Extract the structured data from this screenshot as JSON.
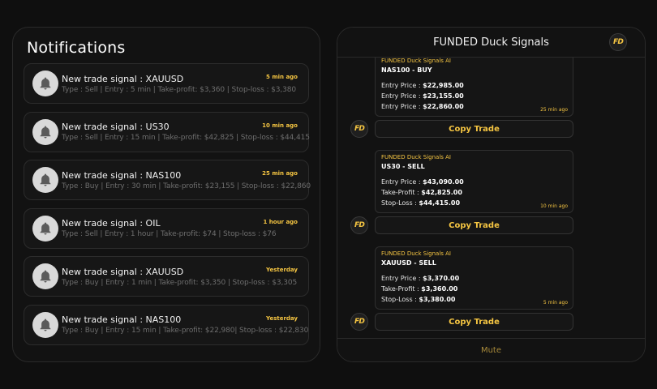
{
  "notifications": {
    "title": "Notifications",
    "items": [
      {
        "title": "New trade signal : XAUUSD",
        "details": "Type : Sell | Entry : 5 min | Take-profit: $3,360 | Stop-loss : $3,380",
        "time": "5 min ago"
      },
      {
        "title": "New trade signal : US30",
        "details": "Type : Sell | Entry : 15 min | Take-profit: $42,825 | Stop-loss : $44,415",
        "time": "10 min ago"
      },
      {
        "title": "New trade signal : NAS100",
        "details": "Type : Buy | Entry : 30 min | Take-profit: $23,155 | Stop-loss : $22,860",
        "time": "25 min ago"
      },
      {
        "title": "New trade signal : OIL",
        "details": "Type : Sell | Entry : 1 hour | Take-profit: $74 | Stop-loss : $76",
        "time": "1 hour ago"
      },
      {
        "title": "New trade signal : XAUUSD",
        "details": "Type : Buy | Entry : 1 min | Take-profit: $3,350 | Stop-loss : $3,305",
        "time": "Yesterday"
      },
      {
        "title": "New trade signal : NAS100",
        "details": "Type : Buy | Entry : 15 min | Take-profit: $22,980| Stop-loss : $22,830",
        "time": "Yesterday"
      }
    ]
  },
  "chat": {
    "title": "FUNDED Duck Signals",
    "logo_text": "FD",
    "mute_label": "Mute",
    "copy_label": "Copy Trade",
    "messages": [
      {
        "sender": "FUNDED Duck Signals AI",
        "pair": "NAS100 - BUY",
        "lines": [
          {
            "label": "Entry Price :",
            "value": "$22,985.00"
          },
          {
            "label": "Entry Price :",
            "value": "$23,155.00"
          },
          {
            "label": "Entry Price :",
            "value": "$22,860.00"
          }
        ],
        "time": "25 min ago"
      },
      {
        "sender": "FUNDED Duck Signals AI",
        "pair": "US30 - SELL",
        "lines": [
          {
            "label": "Entry Price :",
            "value": "$43,090.00"
          },
          {
            "label": "Take-Profit :",
            "value": "$42,825.00"
          },
          {
            "label": "Stop-Loss :",
            "value": "$44,415.00"
          }
        ],
        "time": "10 min ago"
      },
      {
        "sender": "FUNDED Duck Signals AI",
        "pair": "XAUUSD - SELL",
        "lines": [
          {
            "label": "Entry Price :",
            "value": "$3,370.00"
          },
          {
            "label": "Take-Profit :",
            "value": "$3,360.00"
          },
          {
            "label": "Stop-Loss :",
            "value": "$3,380.00"
          }
        ],
        "time": "5 min ago"
      }
    ]
  },
  "colors": {
    "accent": "#f5c542",
    "background": "#0f0f0f",
    "panel": "#121212"
  },
  "icons": {
    "notification": "bell-icon",
    "brand": "funded-duck-logo-icon"
  }
}
